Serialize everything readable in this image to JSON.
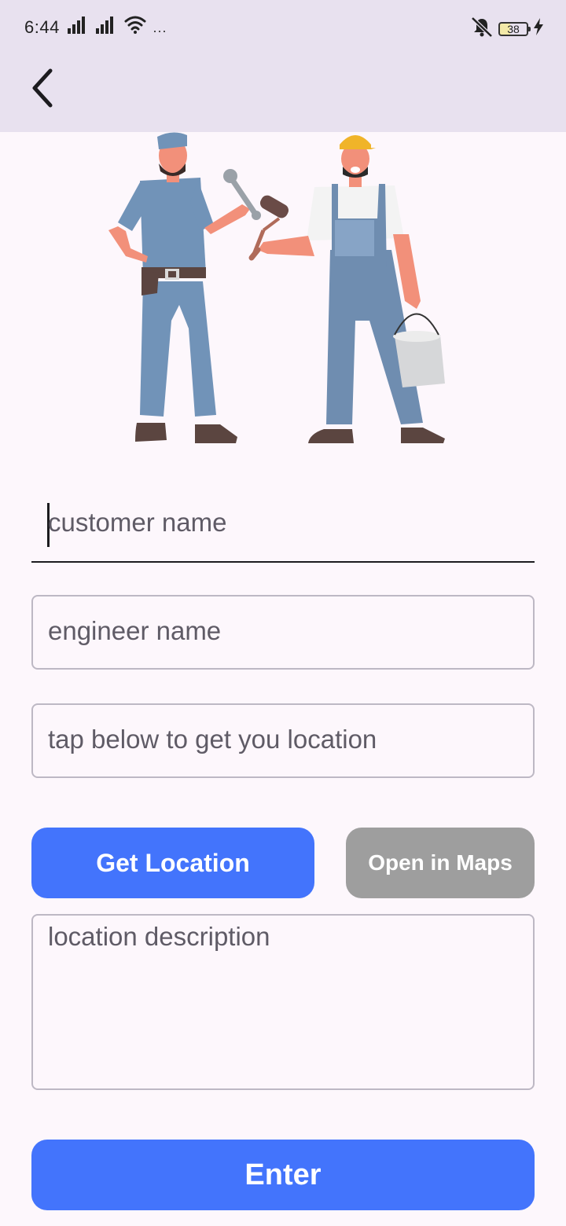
{
  "status_bar": {
    "time": "6:44",
    "more_indicator": "···",
    "battery_level": "38",
    "icons": [
      "signal-icon",
      "signal-icon",
      "wifi-icon",
      "more-dots-icon",
      "mute-vibrate-icon",
      "battery-icon",
      "charging-icon"
    ]
  },
  "app_bar": {
    "back_icon": "chevron-left-icon"
  },
  "illustration": {
    "icon": "workers-illustration"
  },
  "form": {
    "customer_name_placeholder": "customer name",
    "engineer_name_placeholder": "engineer name",
    "location_placeholder": "tap below to get you location",
    "location_description_placeholder": "location description"
  },
  "buttons": {
    "get_location_label": "Get Location",
    "open_maps_label": "Open in Maps",
    "enter_label": "Enter"
  },
  "colors": {
    "primary": "#4374fc",
    "disabled": "#9e9e9e",
    "app_bar_bg": "#e8e1ef",
    "page_bg": "#fdf7fc"
  }
}
